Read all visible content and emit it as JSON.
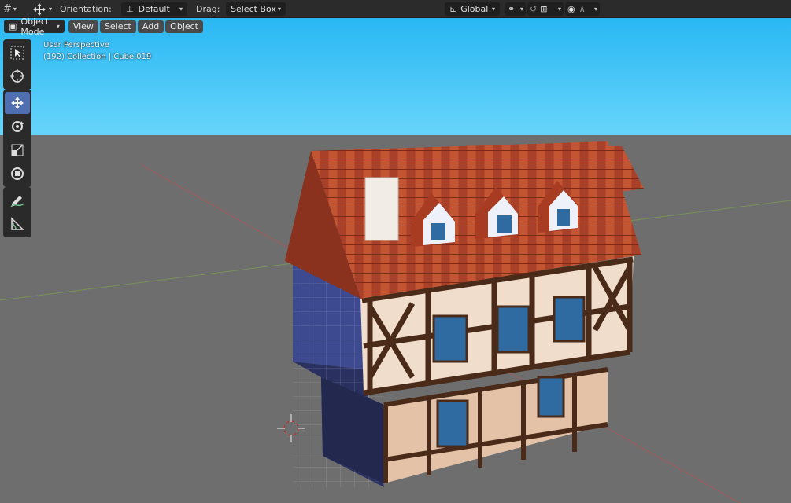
{
  "header": {
    "orientation_label": "Orientation:",
    "orientation_value": "Default",
    "drag_label": "Drag:",
    "drag_value": "Select Box",
    "transform_space": "Global"
  },
  "viewport_header": {
    "mode": "Object Mode",
    "menus": [
      "View",
      "Select",
      "Add",
      "Object"
    ]
  },
  "overlay": {
    "view_name": "User Perspective",
    "collection_info": "(192) Collection | Cube.019"
  },
  "toolbar": {
    "tools": [
      "select-box",
      "cursor",
      "move",
      "rotate",
      "scale",
      "transform",
      "annotate",
      "measure"
    ],
    "active_tool": "move"
  },
  "colors": {
    "sky": "#40c4f5",
    "ground": "#6e6e6e",
    "roof": "#b84a2a",
    "timber": "#4a2a18",
    "plaster": "#f0ddcc",
    "window": "#2f6aa0",
    "active_tool": "#4f6fb0"
  }
}
